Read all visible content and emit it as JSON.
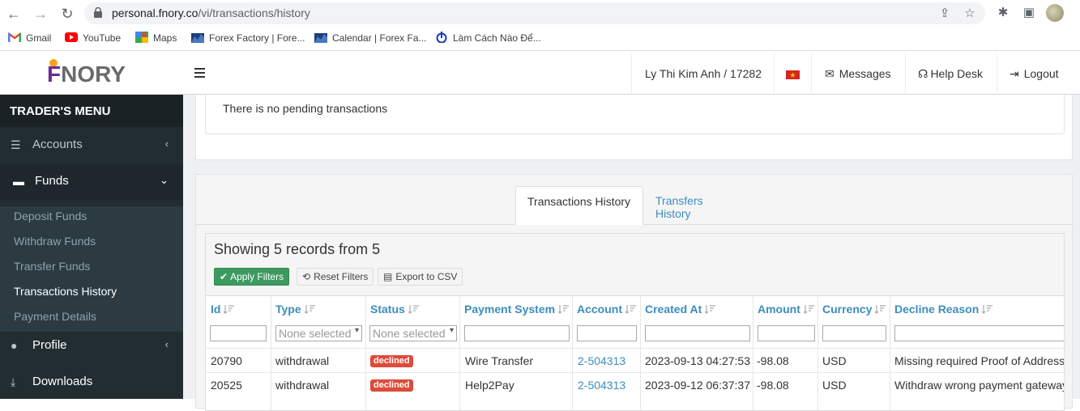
{
  "browser": {
    "url_host": "personal.fnory.co",
    "url_path": "/vi/transactions/history",
    "bookmarks": [
      {
        "label": "Gmail",
        "icon": "gmail-icon"
      },
      {
        "label": "YouTube",
        "icon": "youtube-icon"
      },
      {
        "label": "Maps",
        "icon": "maps-icon"
      },
      {
        "label": "Forex Factory | Fore...",
        "icon": "forexfactory-icon"
      },
      {
        "label": "Calendar | Forex Fa...",
        "icon": "forexfactory-icon"
      },
      {
        "label": "Làm Cách Nào Để...",
        "icon": "power-icon"
      }
    ]
  },
  "brand": {
    "logo_f": "F",
    "logo_rest": "NORY"
  },
  "sidebar": {
    "header": "TRADER'S MENU",
    "items": [
      {
        "label": "Accounts",
        "icon": "list-icon"
      },
      {
        "label": "Funds",
        "icon": "wallet-icon"
      },
      {
        "label": "Profile",
        "icon": "user-icon"
      },
      {
        "label": "Downloads",
        "icon": "download-icon"
      }
    ],
    "submenu": [
      {
        "label": "Deposit Funds"
      },
      {
        "label": "Withdraw Funds"
      },
      {
        "label": "Transfer Funds"
      },
      {
        "label": "Transactions History"
      },
      {
        "label": "Payment Details"
      }
    ]
  },
  "topbar": {
    "user": "Ly Thi Kim Anh / 17282",
    "flag": "vn-flag-icon",
    "messages": "Messages",
    "helpdesk": "Help Desk",
    "logout": "Logout"
  },
  "pending": {
    "text": "There is no pending transactions"
  },
  "tabs": [
    {
      "label": "Transactions History"
    },
    {
      "label": "Transfers History"
    }
  ],
  "records": {
    "title": "Showing 5 records from 5",
    "apply": "Apply Filters",
    "reset": "Reset Filters",
    "export": "Export to CSV"
  },
  "table": {
    "columns": [
      "Id",
      "Type",
      "Status",
      "Payment System",
      "Account",
      "Created At",
      "Amount",
      "Currency",
      "Decline Reason"
    ],
    "type_placeholder": "None selected",
    "status_placeholder": "None selected",
    "rows": [
      {
        "id": "20790",
        "type": "withdrawal",
        "status": "declined",
        "payment": "Wire Transfer",
        "account": "2-504313",
        "created": "2023-09-13 04:27:53",
        "amount": "-98.08",
        "currency": "USD",
        "reason": "Missing required Proof of Address"
      },
      {
        "id": "20525",
        "type": "withdrawal",
        "status": "declined",
        "payment": "Help2Pay",
        "account": "2-504313",
        "created": "2023-09-12 06:37:37",
        "amount": "-98.08",
        "currency": "USD",
        "reason": "Withdraw wrong payment gateway"
      }
    ]
  },
  "colors": {
    "accent": "#3c8dbc",
    "sidebar": "#222d32",
    "badge": "#dd4b39",
    "green": "#3d9a5f"
  }
}
